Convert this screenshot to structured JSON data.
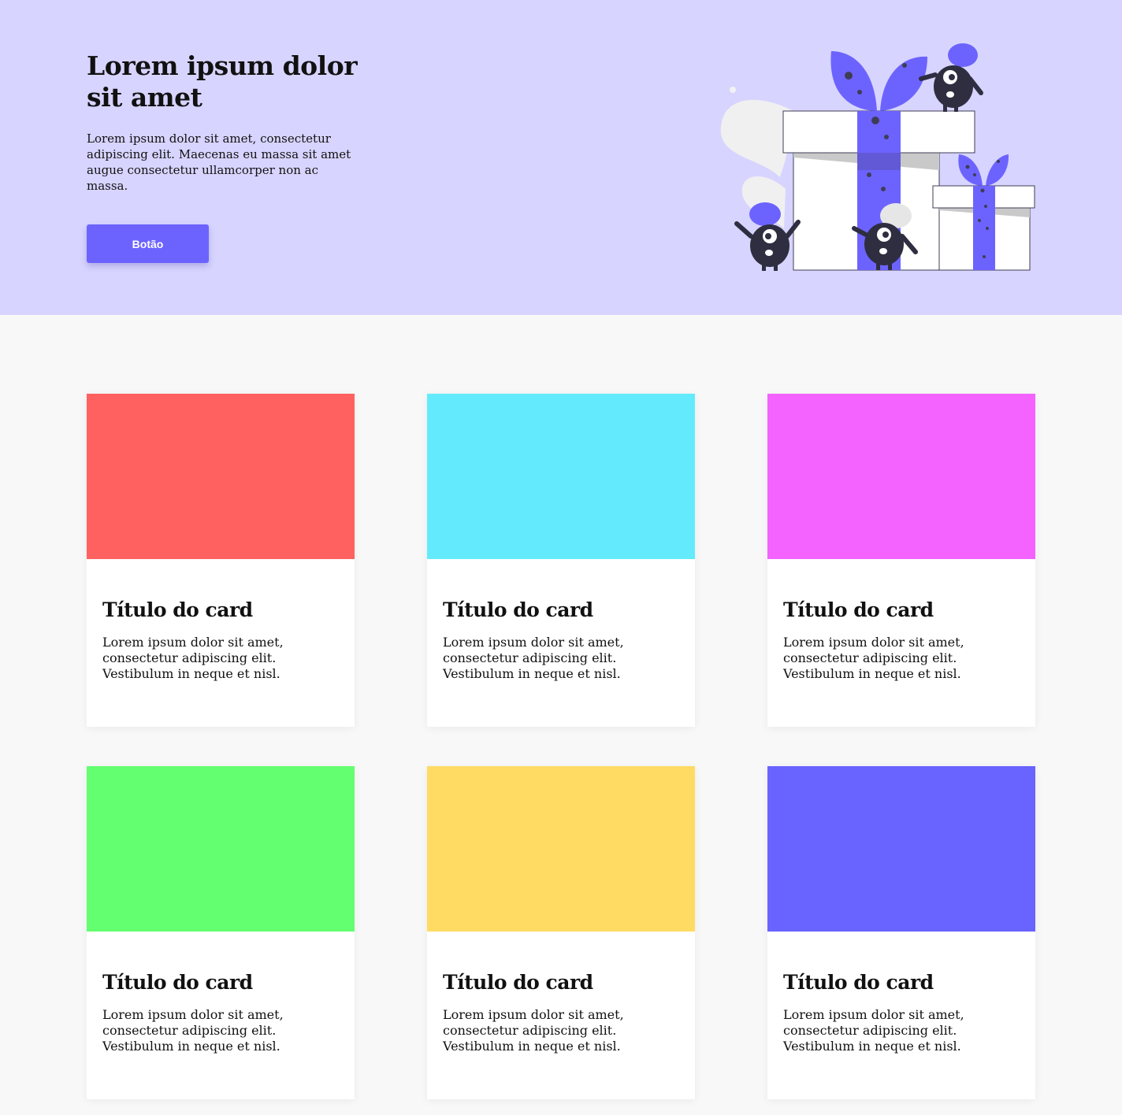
{
  "hero": {
    "title": "Lorem ipsum dolor sit amet",
    "description": "Lorem ipsum dolor sit amet, consectetur adipiscing elit. Maecenas eu massa sit amet augue consectetur ullamcorper non ac massa.",
    "button_label": "Botão",
    "background_color": "#d7d4ff",
    "accent_color": "#6c63ff",
    "illustration": "gift-boxes-with-monsters-illustration"
  },
  "cards": [
    {
      "color": "#ff6161",
      "title": "Título do card",
      "text": "Lorem ipsum dolor sit amet, consectetur adipiscing elit. Vestibulum in neque et nisl."
    },
    {
      "color": "#63ebfd",
      "title": "Título do card",
      "text": "Lorem ipsum dolor sit amet, consectetur adipiscing elit. Vestibulum in neque et nisl."
    },
    {
      "color": "#f463ff",
      "title": "Título do card",
      "text": "Lorem ipsum dolor sit amet, consectetur adipiscing elit. Vestibulum in neque et nisl."
    },
    {
      "color": "#63ff70",
      "title": "Título do card",
      "text": "Lorem ipsum dolor sit amet, consectetur adipiscing elit. Vestibulum in neque et nisl."
    },
    {
      "color": "#ffdb63",
      "title": "Título do card",
      "text": "Lorem ipsum dolor sit amet, consectetur adipiscing elit. Vestibulum in neque et nisl."
    },
    {
      "color": "#6963ff",
      "title": "Título do card",
      "text": "Lorem ipsum dolor sit amet, consectetur adipiscing elit. Vestibulum in neque et nisl."
    }
  ]
}
